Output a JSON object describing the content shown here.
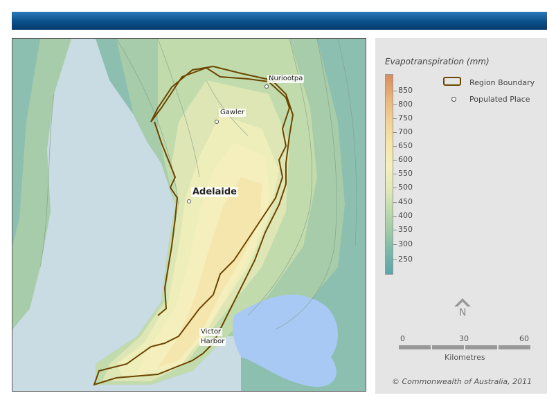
{
  "legend": {
    "title": "Evapotranspiration (mm)",
    "ticks": [
      "850",
      "800",
      "750",
      "700",
      "650",
      "600",
      "550",
      "500",
      "450",
      "400",
      "350",
      "300",
      "250"
    ],
    "region_boundary_label": "Region Boundary",
    "populated_place_label": "Populated Place",
    "north_label": "N",
    "scale_ticks": [
      "0",
      "30",
      "60"
    ],
    "scale_unit": "Kilometres",
    "copyright": "© Commonwealth of Australia, 2011"
  },
  "map": {
    "places": [
      "Nuriootpa",
      "Gawler",
      "Adelaide",
      "Victor",
      "Harbor"
    ]
  },
  "colors": {
    "banner": "#0a4f8a",
    "sea": "#c9dbe3",
    "lake": "#a9c9f5",
    "boundary": "#6b4500"
  }
}
